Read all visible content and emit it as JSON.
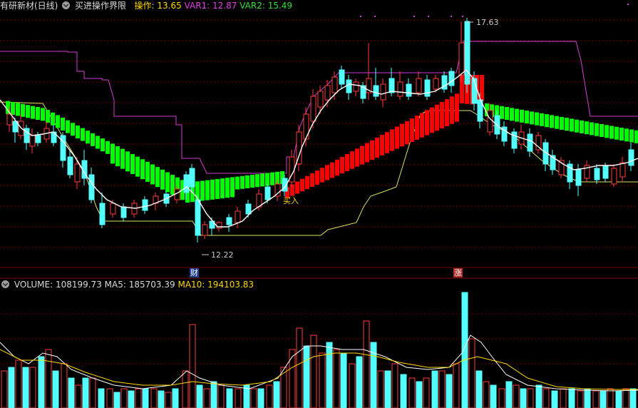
{
  "header": {
    "stock_title": "有研新材(日线)",
    "indicator_name": "买进操作界限",
    "caozuo_label": "操作: ",
    "caozuo_value": "13.65",
    "var1_label": "VAR1: ",
    "var1_value": "12.87",
    "var2_label": "VAR2: ",
    "var2_value": "15.49"
  },
  "price_annotations": {
    "high_label": "17.63",
    "low_label": "12.22",
    "buy_signal": "买入"
  },
  "event_badges": {
    "cai": "财",
    "zhang": "涨"
  },
  "volume_header": {
    "volume_label": "VOLUME: ",
    "volume_value": "108199.73",
    "ma5_label": "MA5: ",
    "ma5_value": "185703.39",
    "ma10_label": "MA10: ",
    "ma10_value": "194103.83"
  },
  "colors": {
    "up_candle": "#ff3c3c",
    "down_candle": "#54ffff",
    "green_band": "#00ff00",
    "red_band": "#ff0000",
    "var1_line": "#d040d0",
    "support_line": "#e0e060",
    "price_ma": "#ffffff",
    "grid": "#7a0000"
  },
  "chart_data": {
    "type": "candlestick",
    "price_high": 17.63,
    "price_low": 12.22,
    "current_volume": 108199.73,
    "volume_ma5": 185703.39,
    "volume_ma10": 194103.83
  }
}
